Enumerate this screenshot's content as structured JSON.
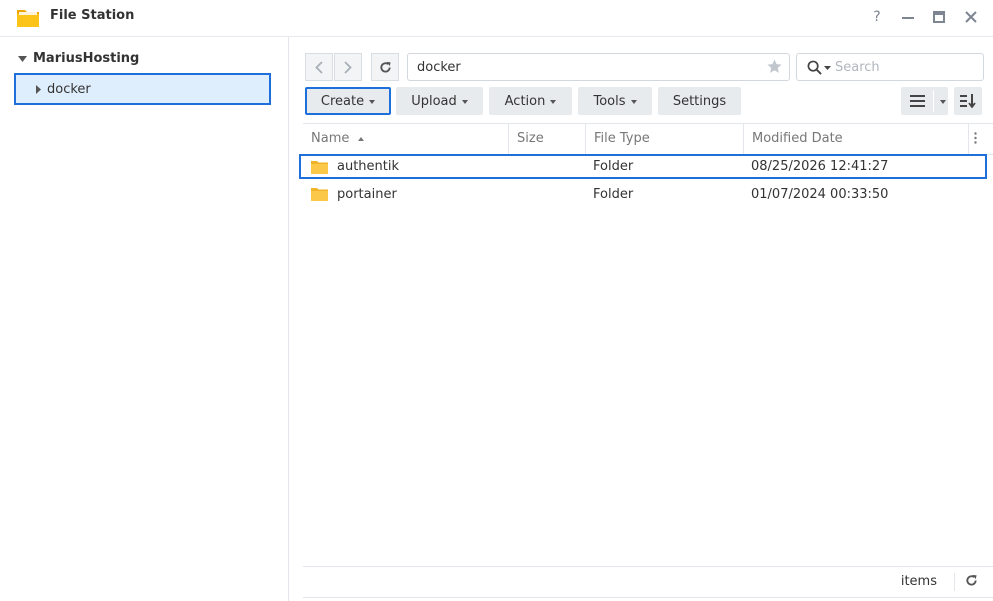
{
  "app": {
    "title": "File Station",
    "icon": "folder-app-icon",
    "window_buttons": [
      "?",
      "minimize",
      "maximize",
      "close"
    ]
  },
  "sidebar": {
    "root": {
      "label": "MariusHosting",
      "expanded": true
    },
    "items": [
      {
        "label": "docker",
        "selected": true
      }
    ]
  },
  "toolbar": {
    "path": "docker",
    "search_placeholder": "Search",
    "buttons": {
      "create": "Create",
      "upload": "Upload",
      "action": "Action",
      "tools": "Tools",
      "settings": "Settings"
    }
  },
  "grid": {
    "columns": {
      "name": "Name",
      "size": "Size",
      "type": "File Type",
      "modified": "Modified Date"
    },
    "rows": [
      {
        "name": "authentik",
        "size": "",
        "type": "Folder",
        "modified": "08/25/2026 12:41:27",
        "selected": true
      },
      {
        "name": "portainer",
        "size": "",
        "type": "Folder",
        "modified": "01/07/2024 00:33:50",
        "selected": false
      }
    ]
  },
  "status": {
    "items_label": "items"
  },
  "colors": {
    "accent": "#1e6fd9",
    "folder": "#f7c33a",
    "selection_bg": "#dfeefc"
  }
}
